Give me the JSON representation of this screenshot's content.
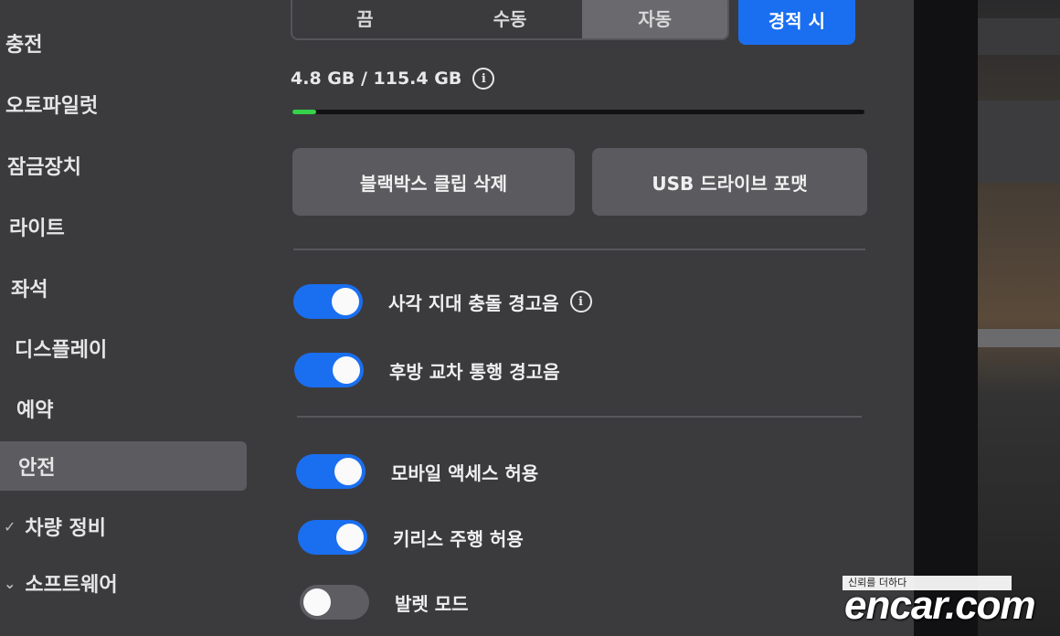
{
  "sidebar": {
    "items": [
      {
        "label": "충전",
        "active": false
      },
      {
        "label": "오토파일럿",
        "active": false
      },
      {
        "label": "잠금장치",
        "active": false
      },
      {
        "label": "라이트",
        "active": false
      },
      {
        "label": "좌석",
        "active": false
      },
      {
        "label": "디스플레이",
        "active": false
      },
      {
        "label": "예약",
        "active": false
      },
      {
        "label": "안전",
        "active": true
      },
      {
        "label": "차량 정비",
        "active": false
      },
      {
        "label": "소프트웨어",
        "active": false
      }
    ]
  },
  "sentry": {
    "options": [
      "끔",
      "수동",
      "자동"
    ],
    "selected": "자동",
    "alarm_label": "경적 시"
  },
  "storage": {
    "label": "4.8 GB / 115.4 GB",
    "used_fraction": 0.042
  },
  "buttons": {
    "delete_clips": "블랙박스 클립 삭제",
    "format_usb": "USB 드라이브 포맷"
  },
  "toggles": {
    "blind_spot": {
      "label": "사각 지대 충돌 경고음",
      "on": true
    },
    "rear_cross": {
      "label": "후방 교차 통행 경고음",
      "on": true
    },
    "mobile_access": {
      "label": "모바일 액세스 허용",
      "on": true
    },
    "keyless": {
      "label": "키리스 주행 허용",
      "on": true
    },
    "valet": {
      "label": "발렛 모드",
      "on": false
    }
  },
  "watermark": {
    "tagline": "신뢰를 더하다",
    "brand": "encar.com"
  },
  "colors": {
    "accent": "#1a6ff0",
    "progress": "#35d24a",
    "background": "#3b3b3e"
  }
}
